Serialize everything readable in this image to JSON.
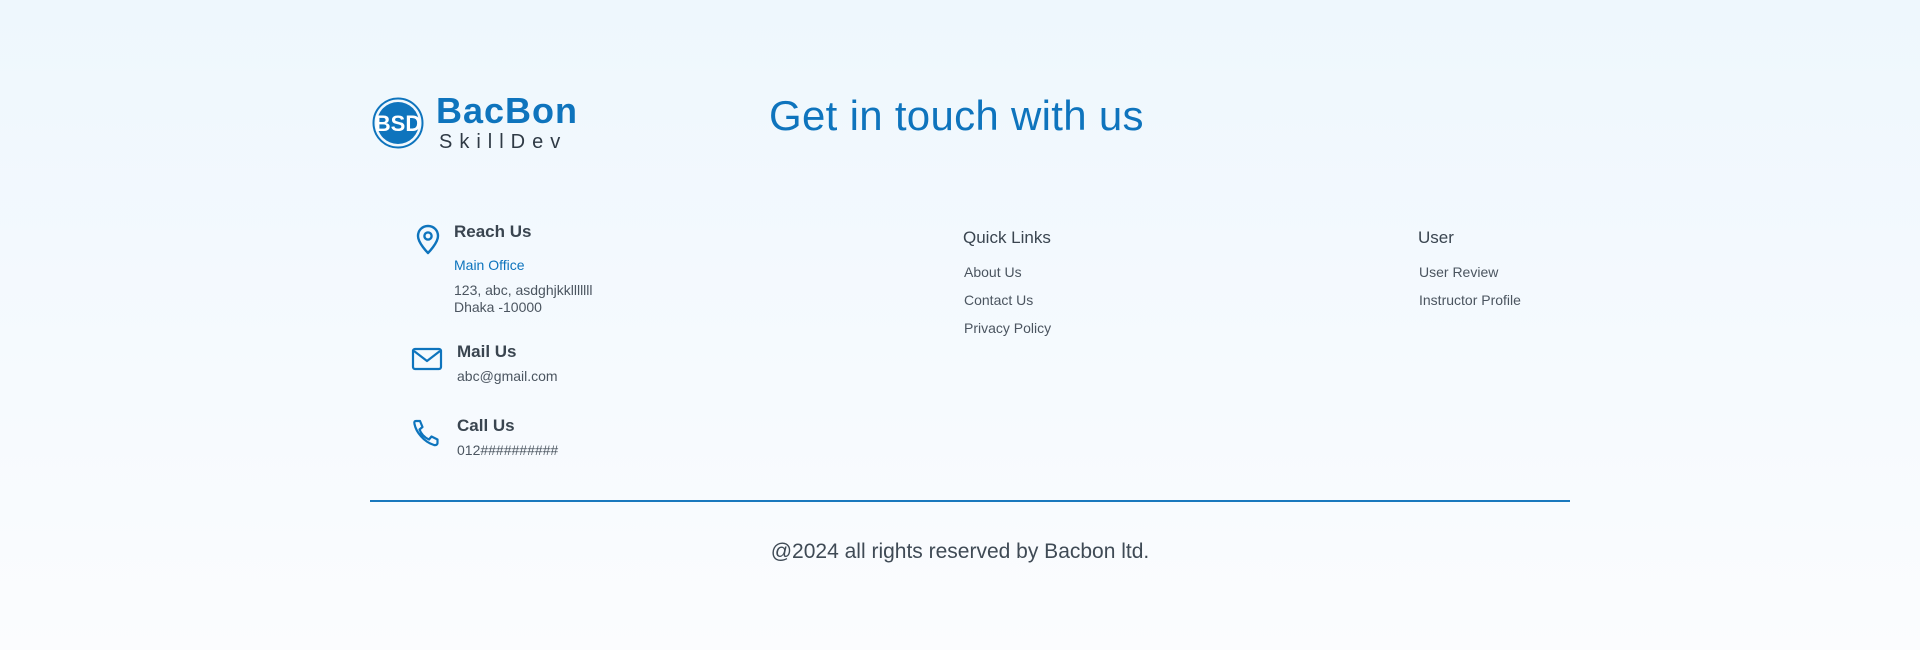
{
  "brand": {
    "name": "BacBon",
    "tagline": "SkillDev",
    "logo_letters": "BSD",
    "color": "#0e74bd"
  },
  "headline": "Get in touch with us",
  "reach": {
    "title": "Reach Us",
    "office_label": "Main Office",
    "address_line1": "123, abc, asdghjkklllllll",
    "address_line2": "Dhaka -10000",
    "icon": "map-pin-icon"
  },
  "mail": {
    "title": "Mail Us",
    "value": "abc@gmail.com",
    "icon": "envelope-icon"
  },
  "call": {
    "title": "Call Us",
    "value": "012##########",
    "icon": "phone-icon"
  },
  "quick_links": {
    "title": "Quick Links",
    "items": [
      {
        "label": "About Us"
      },
      {
        "label": "Contact Us"
      },
      {
        "label": "Privacy Policy"
      }
    ]
  },
  "user": {
    "title": "User",
    "items": [
      {
        "label": "User Review"
      },
      {
        "label": "Instructor Profile"
      }
    ]
  },
  "copyright": "@2024 all rights reserved by Bacbon ltd.",
  "colors": {
    "accent": "#0e74bd",
    "text": "#3f4a55",
    "divider": "#1a78bd"
  }
}
